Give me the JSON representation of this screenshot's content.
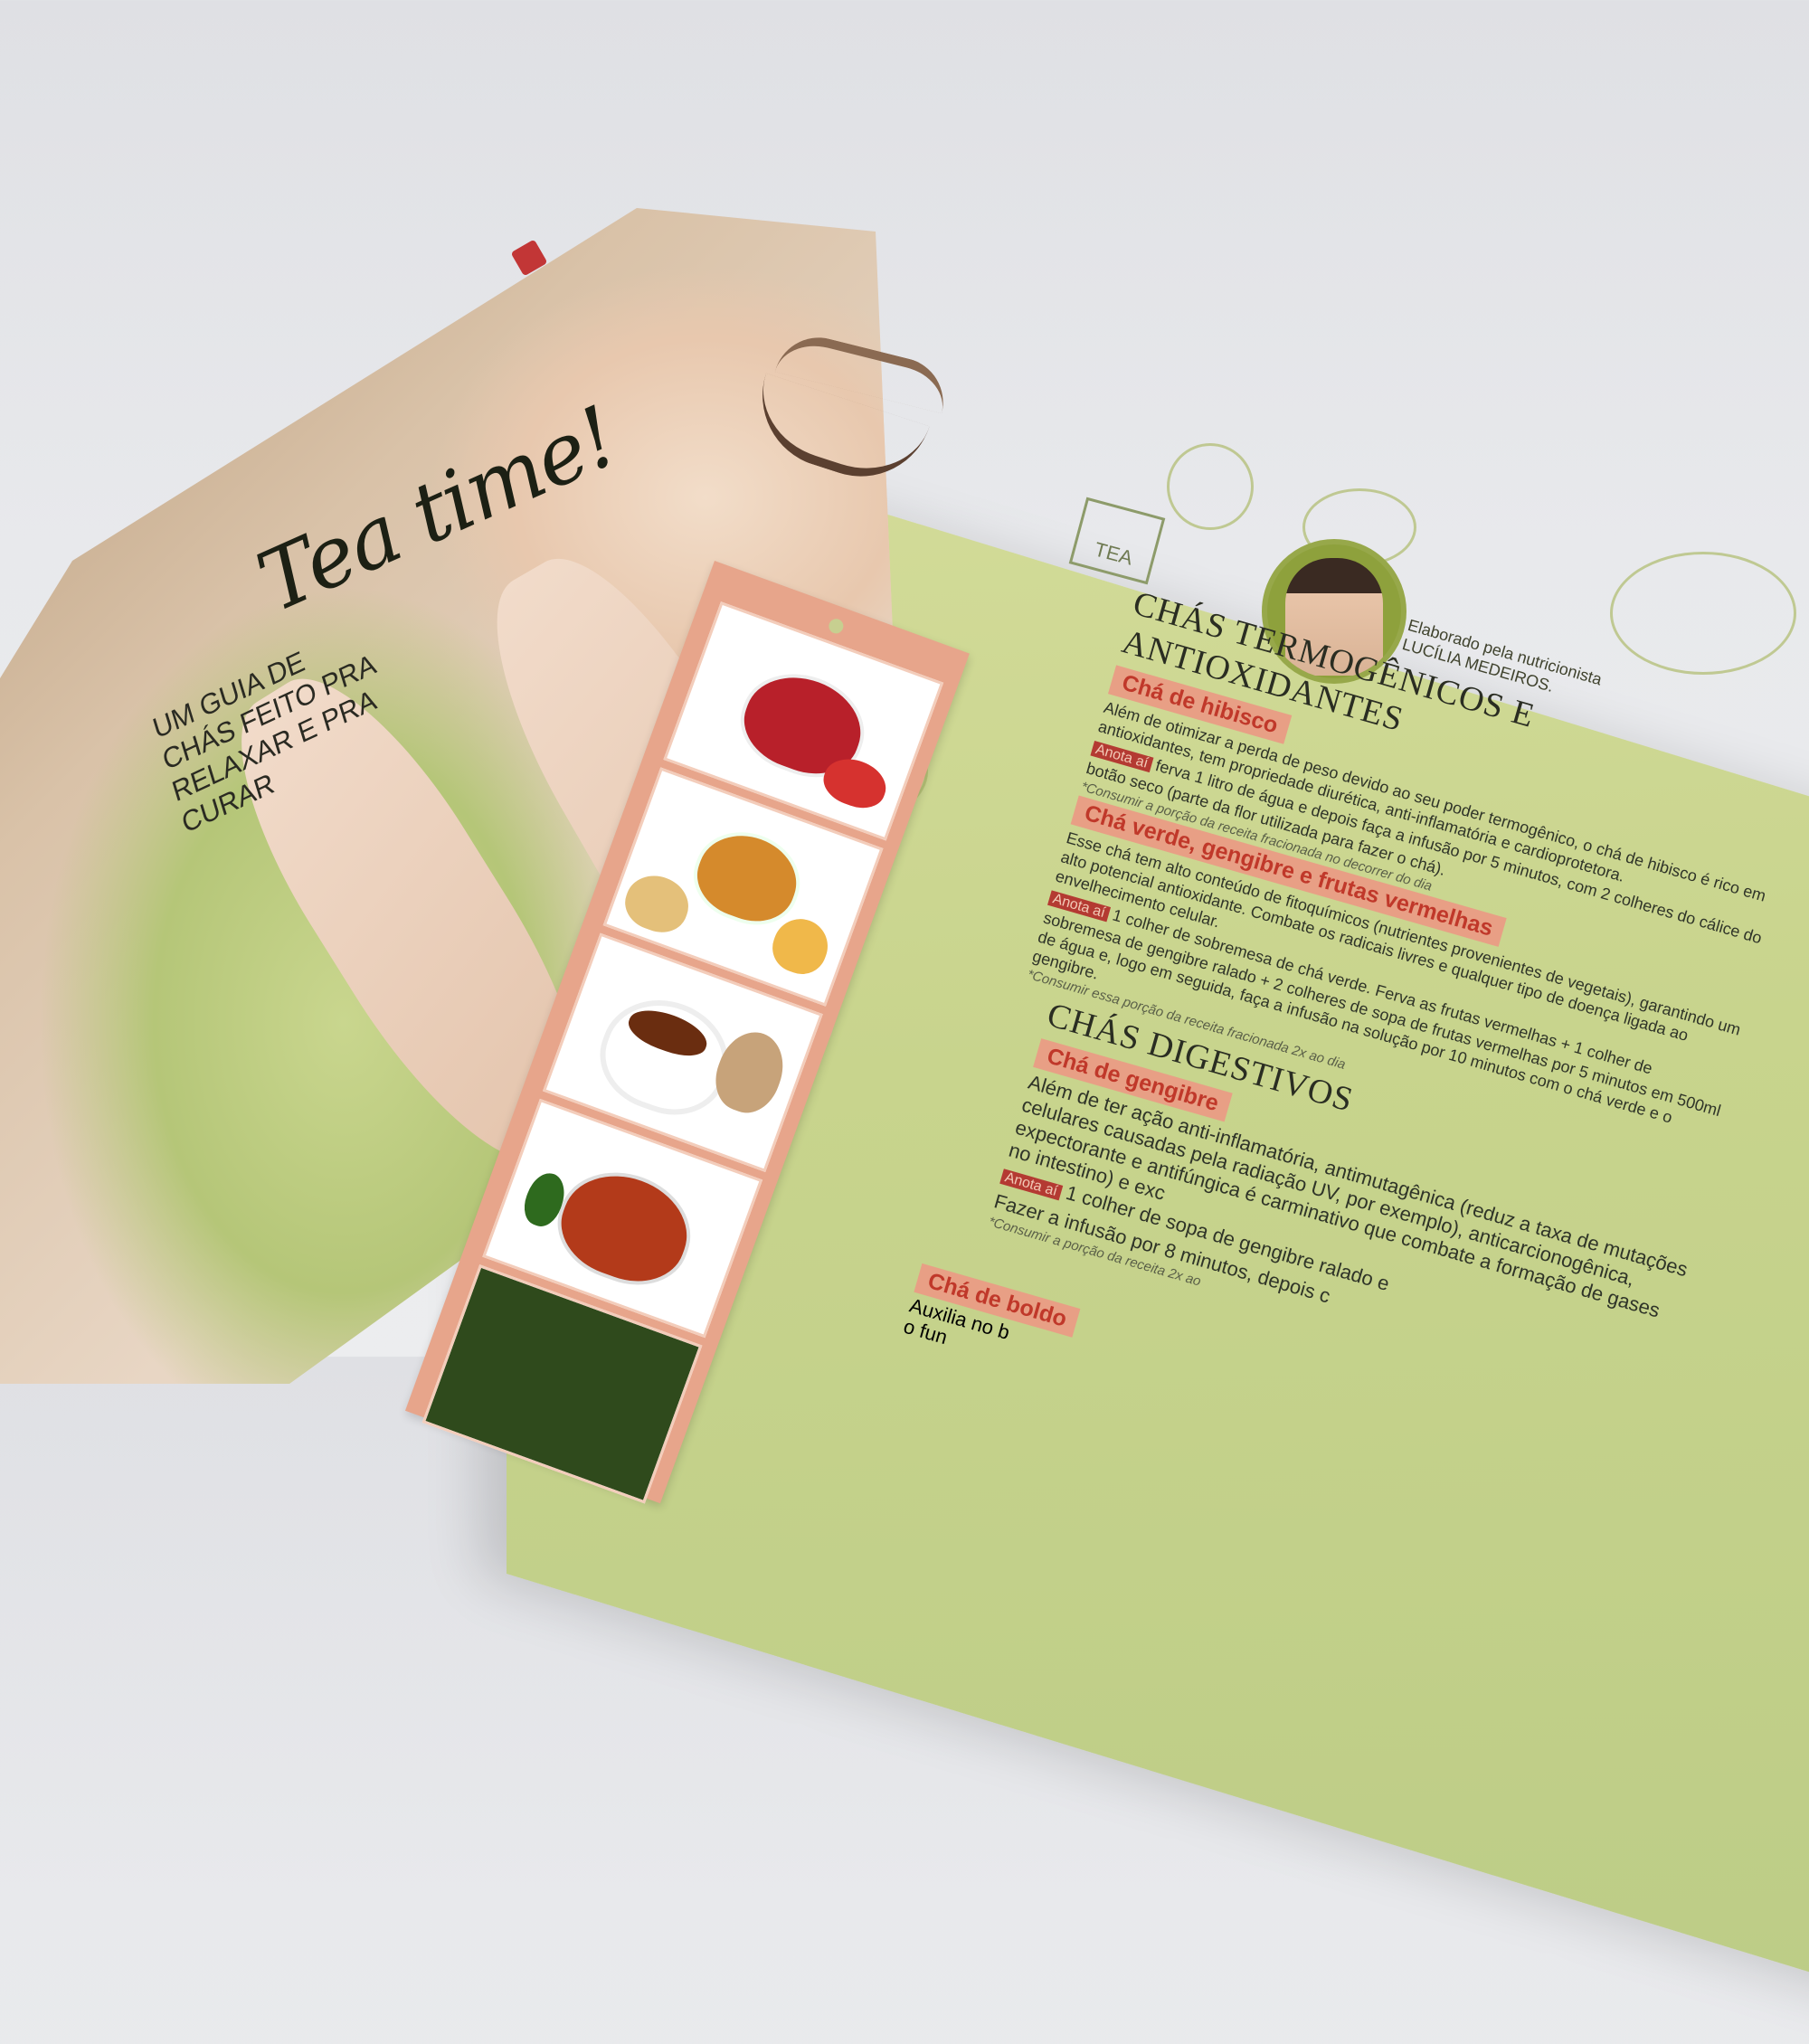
{
  "left_page": {
    "title": "Tea time!",
    "tagline": "UM GUIA DE CHÁS FEITO PRA RELAXAR E PRA CURAR"
  },
  "right_page": {
    "tea_tag": "TEA",
    "credit_line1": "Elaborado pela nutricionista",
    "credit_line2": "LUCÍLIA MEDEIROS.",
    "section1": {
      "title": "CHÁS TERMOGÊNICOS E ANTIOXIDANTES",
      "item1": {
        "name": "Chá de hibisco",
        "text": "Além de otimizar a perda de peso devido ao seu poder termogênico, o chá de hibisco é rico em antioxidantes, tem propriedade diurética, anti-inflamatória e cardioprotetora.",
        "anote_label": "Anota aí",
        "recipe": "ferva 1 litro de água e depois faça a infusão por 5 minutos, com 2 colheres do cálice do botão seco (parte da flor utilizada para fazer o chá).",
        "note": "*Consumir a porção da receita fracionada no decorrer do dia"
      },
      "item2": {
        "name": "Chá verde, gengibre e frutas vermelhas",
        "text": "Esse chá tem alto conteúdo de fitoquímicos (nutrientes provenientes de vegetais), garantindo um alto potencial antioxidante. Combate os radicais livres e qualquer tipo de doença ligada ao envelhecimento celular.",
        "anote_label": "Anota aí",
        "recipe": "1 colher de sobremesa de chá verde. Ferva as frutas vermelhas + 1 colher de sobremesa de gengibre ralado + 2 colheres de sopa de frutas vermelhas por 5 minutos em 500ml de água e, logo em seguida, faça a infusão na solução por 10 minutos com o chá verde e o gengibre.",
        "note": "*Consumir essa porção da receita fracionada 2x ao dia"
      }
    },
    "section2": {
      "title": "CHÁS DIGESTIVOS",
      "item1": {
        "name": "Chá de gengibre",
        "text": "Além de ter ação anti-inflamatória, antimutagênica (reduz a taxa de mutações celulares causadas pela radiação UV, por exemplo), anticarcionogênica, expectorante e antifúngica é carminativo que combate a formação de gases no intestino) e exc",
        "anote_label": "Anota aí",
        "recipe": "1 colher de sopa de gengibre ralado e",
        "recipe2": "Fazer a infusão por 8 minutos, depois c",
        "note": "*Consumir a porção da receita 2x ao"
      },
      "item2": {
        "name": "Chá de boldo",
        "text": "Auxilia no b",
        "text2": "o fun"
      }
    }
  }
}
